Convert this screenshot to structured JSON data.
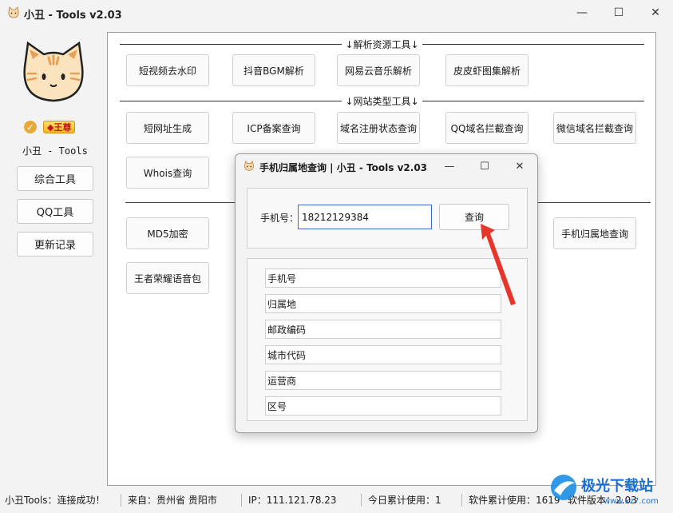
{
  "window": {
    "title": "小丑 - Tools v2.03",
    "controls": {
      "minimize": "—",
      "maximize": "☐",
      "close": "✕"
    }
  },
  "sidebar": {
    "vip_badge": "王尊",
    "username": "小丑 - Tools",
    "buttons": [
      "综合工具",
      "QQ工具",
      "更新记录"
    ]
  },
  "sections": {
    "parse": "↓解析资源工具↓",
    "site": "↓网站类型工具↓"
  },
  "tools": {
    "row1": [
      "短视频去水印",
      "抖音BGM解析",
      "网易云音乐解析",
      "皮皮虾图集解析"
    ],
    "row2": [
      "短网址生成",
      "ICP备案查询",
      "域名注册状态查询",
      "QQ域名拦截查询",
      "微信域名拦截查询"
    ],
    "row3": [
      "Whois查询"
    ],
    "row4_left": "MD5加密",
    "row4_right": "手机归属地查询",
    "row5": "王者荣耀语音包"
  },
  "dialog": {
    "title": "手机归属地查询 | 小丑 - Tools v2.03",
    "controls": {
      "minimize": "—",
      "maximize": "☐",
      "close": "✕"
    },
    "phone_label": "手机号：",
    "phone_value": "18212129384",
    "query_label": "查询",
    "outputs": [
      "手机号",
      "归属地",
      "邮政编码",
      "城市代码",
      "运营商",
      "区号"
    ]
  },
  "status": {
    "connection": "小丑Tools：连接成功！",
    "origin": "来自：贵州省 贵阳市",
    "ip": "IP：111.121.78.23",
    "today": "今日累计使用：1",
    "total": "软件累计使用：1619",
    "version": "软件版本：2.03"
  },
  "watermark": {
    "text": "极光下载站",
    "url": "www.xz7.com"
  },
  "colors": {
    "accent": "#3b6bc8",
    "arrow": "#e8352c",
    "vip": "#f2b523"
  }
}
